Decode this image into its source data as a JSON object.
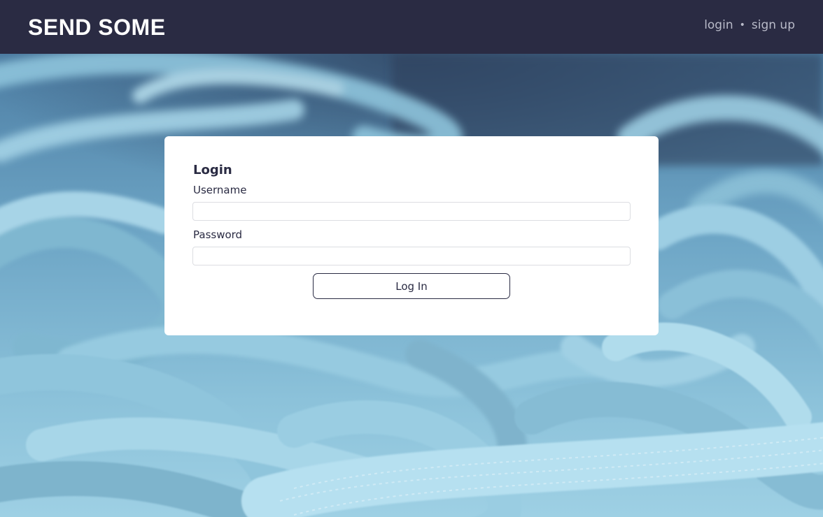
{
  "navbar": {
    "brand": "SEND SOME",
    "login_link": "login",
    "separator": "•",
    "signup_link": "sign up"
  },
  "login_form": {
    "title": "Login",
    "username_label": "Username",
    "username_value": "",
    "password_label": "Password",
    "password_value": "",
    "submit_label": "Log In"
  },
  "colors": {
    "navbar_bg": "#2a2b43",
    "accent_text": "#2a2b43",
    "nav_link": "#b9bbc9",
    "rope_light": "#a9d6e8",
    "rope_mid": "#7eb6d0"
  },
  "background": {
    "subject": "pile of light blue climbing rope"
  }
}
